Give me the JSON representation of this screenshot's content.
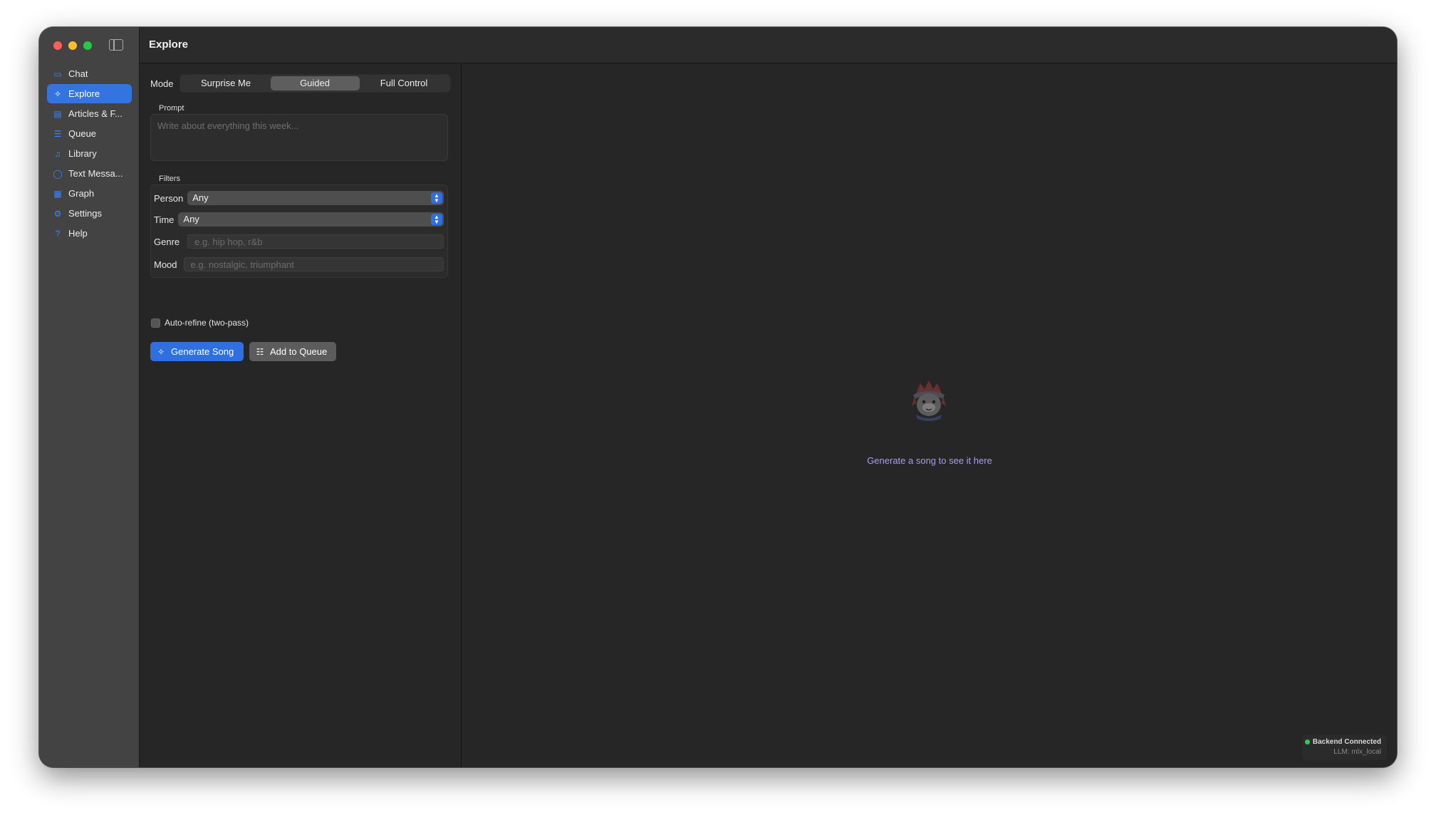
{
  "window": {
    "title": "Explore"
  },
  "sidebar": {
    "items": [
      {
        "label": "Chat",
        "icon": "chat-bubbles-icon",
        "glyph": "▭",
        "active": false
      },
      {
        "label": "Explore",
        "icon": "sparkles-wand-icon",
        "glyph": "✧",
        "active": true
      },
      {
        "label": "Articles & F...",
        "icon": "newspaper-icon",
        "glyph": "▤",
        "active": false
      },
      {
        "label": "Queue",
        "icon": "list-icon",
        "glyph": "☰",
        "active": false
      },
      {
        "label": "Library",
        "icon": "music-notes-icon",
        "glyph": "♫",
        "active": false
      },
      {
        "label": "Text Messa...",
        "icon": "message-bubble-icon",
        "glyph": "◯",
        "active": false
      },
      {
        "label": "Graph",
        "icon": "grid-icon",
        "glyph": "▦",
        "active": false
      },
      {
        "label": "Settings",
        "icon": "gear-icon",
        "glyph": "⚙",
        "active": false
      },
      {
        "label": "Help",
        "icon": "question-circle-icon",
        "glyph": "?",
        "active": false
      }
    ]
  },
  "mode": {
    "label": "Mode",
    "options": [
      "Surprise Me",
      "Guided",
      "Full Control"
    ],
    "selected": "Guided"
  },
  "prompt": {
    "label": "Prompt",
    "placeholder": "Write about everything this week..."
  },
  "filters": {
    "label": "Filters",
    "person": {
      "label": "Person",
      "value": "Any"
    },
    "time": {
      "label": "Time",
      "value": "Any"
    },
    "genre": {
      "label": "Genre",
      "placeholder": "e.g. hip hop, r&b"
    },
    "mood": {
      "label": "Mood",
      "placeholder": "e.g. nostalgic, triumphant"
    }
  },
  "auto_refine": {
    "label": "Auto-refine (two-pass)",
    "checked": false
  },
  "actions": {
    "generate_label": "Generate Song",
    "queue_label": "Add to Queue"
  },
  "detail": {
    "empty_message": "Generate a song to see it here"
  },
  "status": {
    "backend": "Backend Connected",
    "llm": "LLM: mlx_local"
  },
  "colors": {
    "accent": "#2f6fe0",
    "sidebar_bg": "#434343",
    "content_bg": "#262626",
    "status_ok": "#34c759",
    "empty_text": "#a99cf0"
  }
}
